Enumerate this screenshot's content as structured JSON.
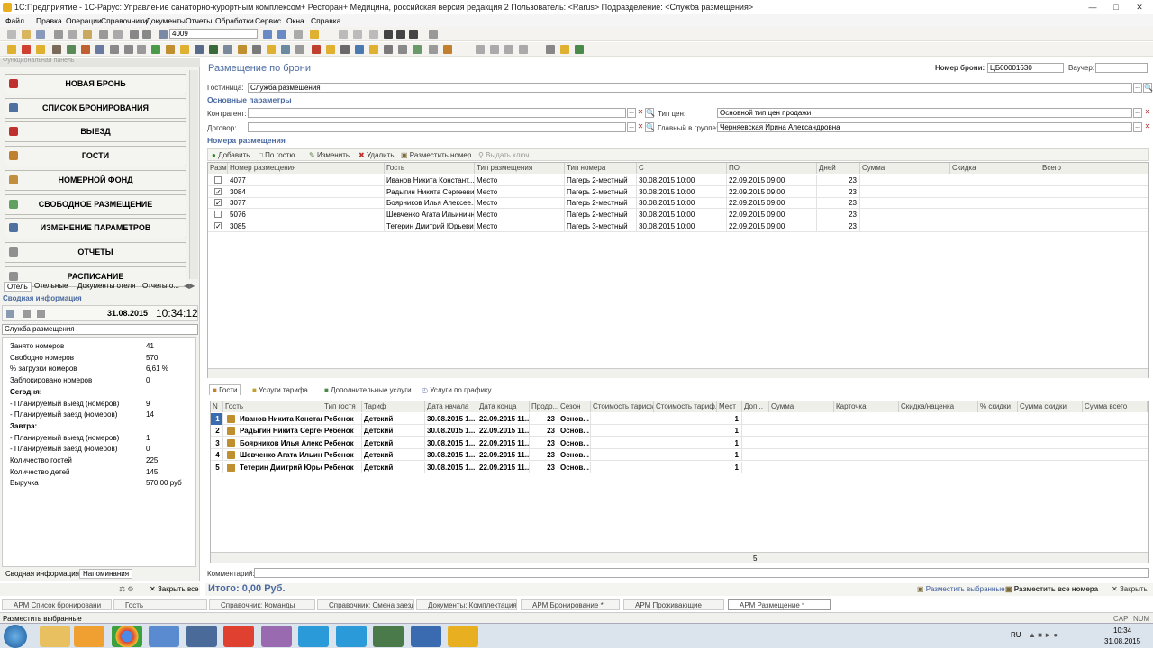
{
  "window": {
    "title": "1С:Предприятие - 1С-Рарус: Управление санаторно-курортным комплексом+ Ресторан+ Медицина, российская версия редакция 2    Пользователь: <Rarus>    Подразделение: <Служба размещения>"
  },
  "menu": [
    "Файл",
    "Правка",
    "Операции",
    "Справочники",
    "Документы",
    "Отчеты",
    "Обработки",
    "Сервис",
    "Окна",
    "Справка"
  ],
  "toolbar": {
    "search_value": "4009"
  },
  "sidebar": {
    "header": "Функциональная панель",
    "nav": [
      {
        "label": "НОВАЯ БРОНЬ",
        "color": "#c03030"
      },
      {
        "label": "СПИСОК БРОНИРОВАНИЯ",
        "color": "#5070a0"
      },
      {
        "label": "ВЫЕЗД",
        "color": "#c03030"
      },
      {
        "label": "ГОСТИ",
        "color": "#c08030"
      },
      {
        "label": "НОМЕРНОЙ ФОНД",
        "color": "#c09040"
      },
      {
        "label": "СВОБОДНОЕ РАЗМЕЩЕНИЕ",
        "color": "#60a060"
      },
      {
        "label": "ИЗМЕНЕНИЕ ПАРАМЕТРОВ",
        "color": "#5070a0"
      },
      {
        "label": "ОТЧЕТЫ",
        "color": "#909090"
      },
      {
        "label": "РАСПИСАНИЕ",
        "color": "#909090"
      }
    ],
    "tabs": [
      "Отель",
      "Отельные",
      "Документы отеля",
      "Отчеты о..."
    ],
    "summary_title": "Сводная информация",
    "date": "31.08.2015",
    "time": "10:34:12",
    "department": "Служба размещения",
    "stats": [
      {
        "label": "Занято номеров",
        "value": "41",
        "bold": false
      },
      {
        "label": "Свободно номеров",
        "value": "570",
        "bold": false
      },
      {
        "label": "% загрузки номеров",
        "value": "6,61 %",
        "bold": false
      },
      {
        "label": "Заблокировано номеров",
        "value": "0",
        "bold": false
      },
      {
        "label": "Сегодня:",
        "value": "",
        "bold": true
      },
      {
        "label": " - Планируемый выезд (номеров)",
        "value": "9",
        "bold": false
      },
      {
        "label": " - Планируемый заезд (номеров)",
        "value": "14",
        "bold": false
      },
      {
        "label": "Завтра:",
        "value": "",
        "bold": true
      },
      {
        "label": " - Планируемый выезд (номеров)",
        "value": "1",
        "bold": false
      },
      {
        "label": " - Планируемый заезд (номеров)",
        "value": "0",
        "bold": false
      },
      {
        "label": "Количество гостей",
        "value": "225",
        "bold": false
      },
      {
        "label": "Количество детей",
        "value": "145",
        "bold": false
      },
      {
        "label": "Выручка",
        "value": "570,00 руб",
        "bold": false
      }
    ],
    "bottom_tabs": [
      "Сводная информация",
      "Напоминания"
    ],
    "close_all": "Закрыть все"
  },
  "form": {
    "title": "Размещение по брони",
    "booking_label": "Номер брони:",
    "booking_no": "ЦБ00001630",
    "voucher_label": "Ваучер:",
    "voucher": "",
    "hotel_label": "Гостиница:",
    "hotel": "Служба размещения",
    "main_params": "Основные параметры",
    "contractor_label": "Контрагент:",
    "contractor": "",
    "contract_label": "Договор:",
    "contract": "",
    "price_type_label": "Тип цен:",
    "price_type": "Основной тип цен продажи",
    "group_head_label": "Главный в группе:",
    "group_head": "Черняевская Ирина Александровна",
    "rooms_section": "Номера размещения",
    "rooms_toolbar": [
      "Добавить",
      "По гостю",
      "Изменить",
      "Удалить",
      "Разместить номер",
      "Выдать ключ"
    ],
    "rooms_headers": [
      "Разм.",
      "Номер размещения",
      "Гость",
      "Тип размещения",
      "Тип номера",
      "С",
      "ПО",
      "Дней",
      "Сумма",
      "Скидка",
      "Всего"
    ],
    "rooms": [
      {
        "checked": false,
        "room": "4077",
        "guest": "Иванов Никита Констант...",
        "placement": "Место",
        "room_type": "Пагерь 2-местный",
        "from": "30.08.2015 10:00",
        "to": "22.09.2015 09:00",
        "days": "23"
      },
      {
        "checked": true,
        "room": "3084",
        "guest": "Радыгин Никита Сергееви...",
        "placement": "Место",
        "room_type": "Пагерь 2-местный",
        "from": "30.08.2015 10:00",
        "to": "22.09.2015 09:00",
        "days": "23"
      },
      {
        "checked": true,
        "room": "3077",
        "guest": "Боярников Илья Алексее...",
        "placement": "Место",
        "room_type": "Пагерь 2-местный",
        "from": "30.08.2015 10:00",
        "to": "22.09.2015 09:00",
        "days": "23"
      },
      {
        "checked": false,
        "room": "5076",
        "guest": "Шевченко Агата Ильинична",
        "placement": "Место",
        "room_type": "Пагерь 2-местный",
        "from": "30.08.2015 10:00",
        "to": "22.09.2015 09:00",
        "days": "23"
      },
      {
        "checked": true,
        "room": "3085",
        "guest": "Тетерин Дмитрий Юрьевич",
        "placement": "Место",
        "room_type": "Пагерь 3-местный",
        "from": "30.08.2015 10:00",
        "to": "22.09.2015 09:00",
        "days": "23"
      }
    ],
    "lower_tabs": [
      "Гости",
      "Услуги тарифа",
      "Дополнительные услуги",
      "Услуги по графику"
    ],
    "guests_headers": [
      "N",
      "Гость",
      "Тип гостя",
      "Тариф",
      "Дата начала",
      "Дата конца",
      "Продо...",
      "Сезон",
      "Стоимость тарифа",
      "Стоимость тариф...",
      "Мест",
      "Доп...",
      "Сумма",
      "Карточка",
      "Скидка/наценка",
      "% скидки",
      "Сумма скидки",
      "Сумма всего"
    ],
    "guests": [
      {
        "n": "1",
        "guest": "Иванов Никита Константи...",
        "type": "Ребенок",
        "tariff": "Детский",
        "start": "30.08.2015 1...",
        "end": "22.09.2015 11...",
        "dur": "23",
        "season": "Основ...",
        "places": "1"
      },
      {
        "n": "2",
        "guest": "Радыгин Никита Сергеев...",
        "type": "Ребенок",
        "tariff": "Детский",
        "start": "30.08.2015 1...",
        "end": "22.09.2015 11...",
        "dur": "23",
        "season": "Основ...",
        "places": "1"
      },
      {
        "n": "3",
        "guest": "Боярников Илья Алексее...",
        "type": "Ребенок",
        "tariff": "Детский",
        "start": "30.08.2015 1...",
        "end": "22.09.2015 11...",
        "dur": "23",
        "season": "Основ...",
        "places": "1"
      },
      {
        "n": "4",
        "guest": "Шевченко Агата Ильинич...",
        "type": "Ребенок",
        "tariff": "Детский",
        "start": "30.08.2015 1...",
        "end": "22.09.2015 11...",
        "dur": "23",
        "season": "Основ...",
        "places": "1"
      },
      {
        "n": "5",
        "guest": "Тетерин Дмитрий Юрьевич",
        "type": "Ребенок",
        "tariff": "Детский",
        "start": "30.08.2015 1...",
        "end": "22.09.2015 11...",
        "dur": "23",
        "season": "Основ...",
        "places": "1"
      }
    ],
    "guests_total_places": "5",
    "comment_label": "Комментарий:",
    "comment": "",
    "total": "Итого: 0,00 Руб.",
    "place_selected": "Разместить выбранные",
    "place_all": "Разместить все номера",
    "close": "Закрыть"
  },
  "window_tabs": [
    "АРМ Список бронировани",
    "Гость",
    "Справочник: Команды",
    "Справочник: Смена заезда",
    "Документы: Комплектация ...",
    "АРМ Бронирование *",
    "АРМ Проживающие",
    "АРМ Размещение *"
  ],
  "status": {
    "text": "Разместить выбранные",
    "caps": "CAP",
    "num": "NUM"
  },
  "taskbar": {
    "lang": "RU",
    "time": "10:34",
    "date": "31.08.2015"
  }
}
